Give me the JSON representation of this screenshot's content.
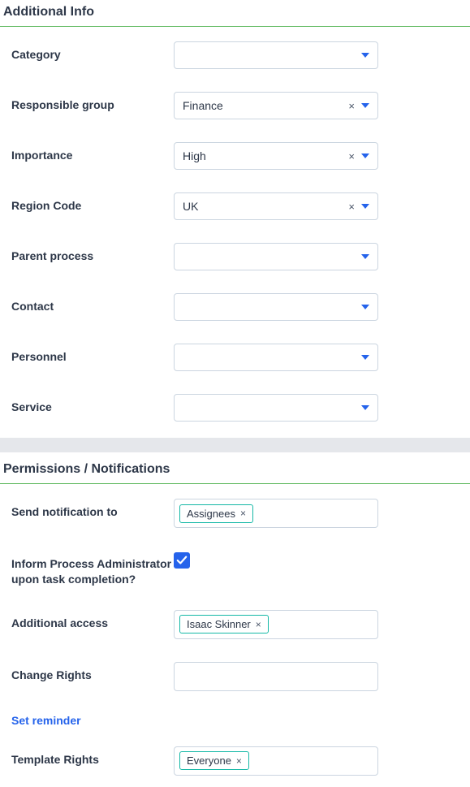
{
  "section1": {
    "title": "Additional Info",
    "fields": {
      "category": {
        "label": "Category",
        "value": ""
      },
      "responsible_group": {
        "label": "Responsible group",
        "value": "Finance",
        "clearable": true
      },
      "importance": {
        "label": "Importance",
        "value": "High",
        "clearable": true
      },
      "region_code": {
        "label": "Region Code",
        "value": "UK",
        "clearable": true
      },
      "parent_process": {
        "label": "Parent process",
        "value": ""
      },
      "contact": {
        "label": "Contact",
        "value": ""
      },
      "personnel": {
        "label": "Personnel",
        "value": ""
      },
      "service": {
        "label": "Service",
        "value": ""
      }
    }
  },
  "section2": {
    "title": "Permissions / Notifications",
    "send_notification": {
      "label": "Send notification to",
      "tag": "Assignees"
    },
    "inform_admin": {
      "label": "Inform Process Administrator upon task completion?",
      "checked": true
    },
    "additional_access": {
      "label": "Additional access",
      "tag": "Isaac Skinner"
    },
    "change_rights": {
      "label": "Change Rights"
    },
    "set_reminder": {
      "label": "Set reminder"
    },
    "template_rights": {
      "label": "Template Rights",
      "tag": "Everyone"
    }
  }
}
